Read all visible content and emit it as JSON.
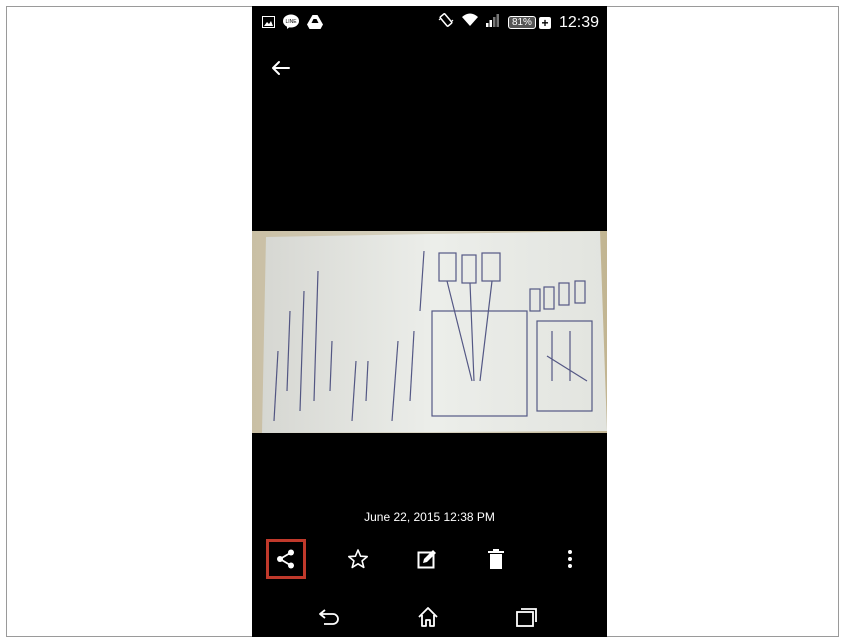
{
  "status_bar": {
    "battery": "81%",
    "time": "12:39",
    "left_icons": [
      "image-notification-icon",
      "line-app-icon",
      "drive-icon"
    ],
    "right_icons": [
      "vibrate-icon",
      "wifi-icon",
      "signal-icon",
      "battery-icon"
    ]
  },
  "viewer": {
    "date": "June 22, 2015 12:38 PM",
    "photo_description": "photo of handwritten paper sketch"
  },
  "actions": [
    "share",
    "favorite",
    "edit",
    "delete",
    "more"
  ],
  "nav_bar": [
    "back",
    "home",
    "recent-apps"
  ],
  "highlight_color": "#c0392b"
}
